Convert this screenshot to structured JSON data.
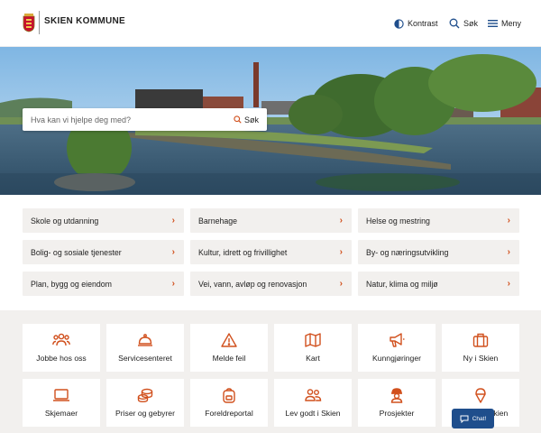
{
  "header": {
    "brand": "SKIEN KOMMUNE",
    "contrast_label": "Kontrast",
    "search_label": "Søk",
    "menu_label": "Meny"
  },
  "hero": {
    "search_placeholder": "Hva kan vi hjelpe deg med?",
    "search_button": "Søk"
  },
  "categories": [
    {
      "label": "Skole og utdanning"
    },
    {
      "label": "Barnehage"
    },
    {
      "label": "Helse og mestring"
    },
    {
      "label": "Bolig- og sosiale tjenester"
    },
    {
      "label": "Kultur, idrett og frivillighet"
    },
    {
      "label": "By- og næringsutvikling"
    },
    {
      "label": "Plan, bygg og eiendom"
    },
    {
      "label": "Vei, vann, avløp og renovasjon"
    },
    {
      "label": "Natur, klima og miljø"
    }
  ],
  "tiles": [
    {
      "label": "Jobbe hos oss",
      "icon": "people-icon"
    },
    {
      "label": "Servicesenteret",
      "icon": "service-bell-icon"
    },
    {
      "label": "Melde feil",
      "icon": "warning-icon"
    },
    {
      "label": "Kart",
      "icon": "map-icon"
    },
    {
      "label": "Kunngjøringer",
      "icon": "megaphone-icon"
    },
    {
      "label": "Ny i Skien",
      "icon": "suitcase-icon"
    },
    {
      "label": "Skjemaer",
      "icon": "laptop-icon"
    },
    {
      "label": "Priser og gebyrer",
      "icon": "coins-icon"
    },
    {
      "label": "Foreldreportal",
      "icon": "backpack-icon"
    },
    {
      "label": "Lev godt i Skien",
      "icon": "people-icon"
    },
    {
      "label": "Prosjekter",
      "icon": "worker-icon"
    },
    {
      "label": "Sommer i Skien",
      "icon": "ice-cream-icon"
    }
  ],
  "chat": {
    "label": "Chat!"
  },
  "colors": {
    "accent": "#d1501d",
    "chat": "#1f4e8c",
    "tile_bg": "#f2f0ee"
  }
}
